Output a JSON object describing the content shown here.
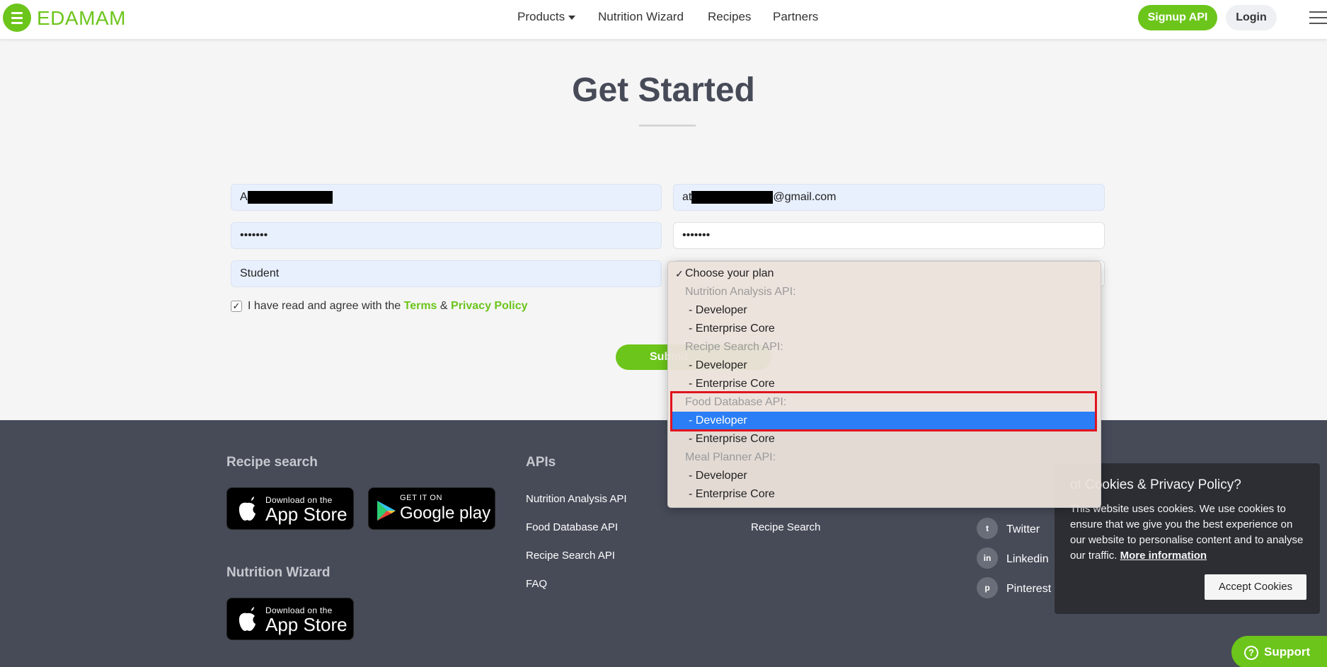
{
  "header": {
    "logo_text": "EDAMAM",
    "nav": {
      "products": "Products",
      "nutrition_wizard": "Nutrition Wizard",
      "recipes": "Recipes",
      "partners": "Partners"
    },
    "signup": "Signup API",
    "login": "Login"
  },
  "page": {
    "title": "Get Started"
  },
  "form": {
    "name_prefix": "A",
    "email_prefix": "at",
    "email_suffix": "@gmail.com",
    "password": "•••••••",
    "password_confirm": "•••••••",
    "organization": "Student",
    "agree_text": "I have read and agree with the",
    "terms": "Terms",
    "amp": "&",
    "privacy": "Privacy Policy",
    "agree_checked": "✓",
    "submit": "Submit"
  },
  "dropdown": {
    "checkmark": "✓",
    "options": [
      "Choose your plan",
      "Nutrition Analysis API:",
      "- Developer",
      "- Enterprise Core",
      "Recipe Search API:",
      "- Developer",
      "- Enterprise Core",
      "Food Database API:",
      "- Developer",
      "- Enterprise Core",
      "Meal Planner API:",
      "- Developer",
      "- Enterprise Core"
    ]
  },
  "footer": {
    "recipe_search_heading": "Recipe search",
    "nutrition_wizard_heading": "Nutrition Wizard",
    "apis_heading": "APIs",
    "app_store_small": "Download on the",
    "app_store_big": "App Store",
    "google_small": "GET IT ON",
    "google_big": "Google play",
    "api_links": [
      "Nutrition Analysis API",
      "Food Database API",
      "Recipe Search API",
      "FAQ"
    ],
    "recipe_search_link": "Recipe Search",
    "social": [
      "Twitter",
      "Linkedin",
      "Pinterest"
    ],
    "social_icon_text": [
      "t",
      "in",
      "p"
    ]
  },
  "cookie": {
    "title": "ot Cookies & Privacy Policy?",
    "text": "This website uses cookies. We use cookies to ensure that we give you the best experience on our website to personalise content and to analyse our traffic.",
    "more": "More information",
    "accept": "Accept Cookies"
  },
  "support": {
    "label": "Support",
    "icon": "?"
  }
}
